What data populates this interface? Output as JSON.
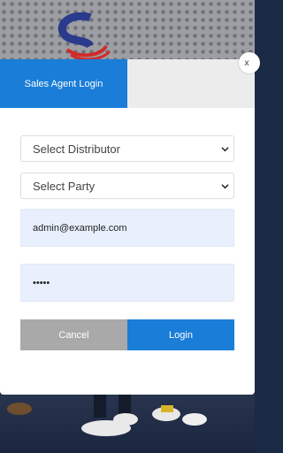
{
  "modal": {
    "tabs": [
      {
        "label": "Sales Agent Login",
        "active": true
      }
    ],
    "close_label": "x",
    "distributor_select": {
      "value": "Select Distributor"
    },
    "party_select": {
      "value": "Select Party"
    },
    "email_field": {
      "value": "admin@example.com"
    },
    "password_field": {
      "value": "•••••"
    },
    "buttons": {
      "cancel": "Cancel",
      "login": "Login"
    }
  },
  "colors": {
    "accent": "#1a7dd8",
    "cancel": "#a9a9a9",
    "input_fill": "#e8f0fe",
    "tab_inactive": "#ececec"
  },
  "icons": [
    "brand-logo",
    "chevron-down-icon",
    "close-icon"
  ]
}
